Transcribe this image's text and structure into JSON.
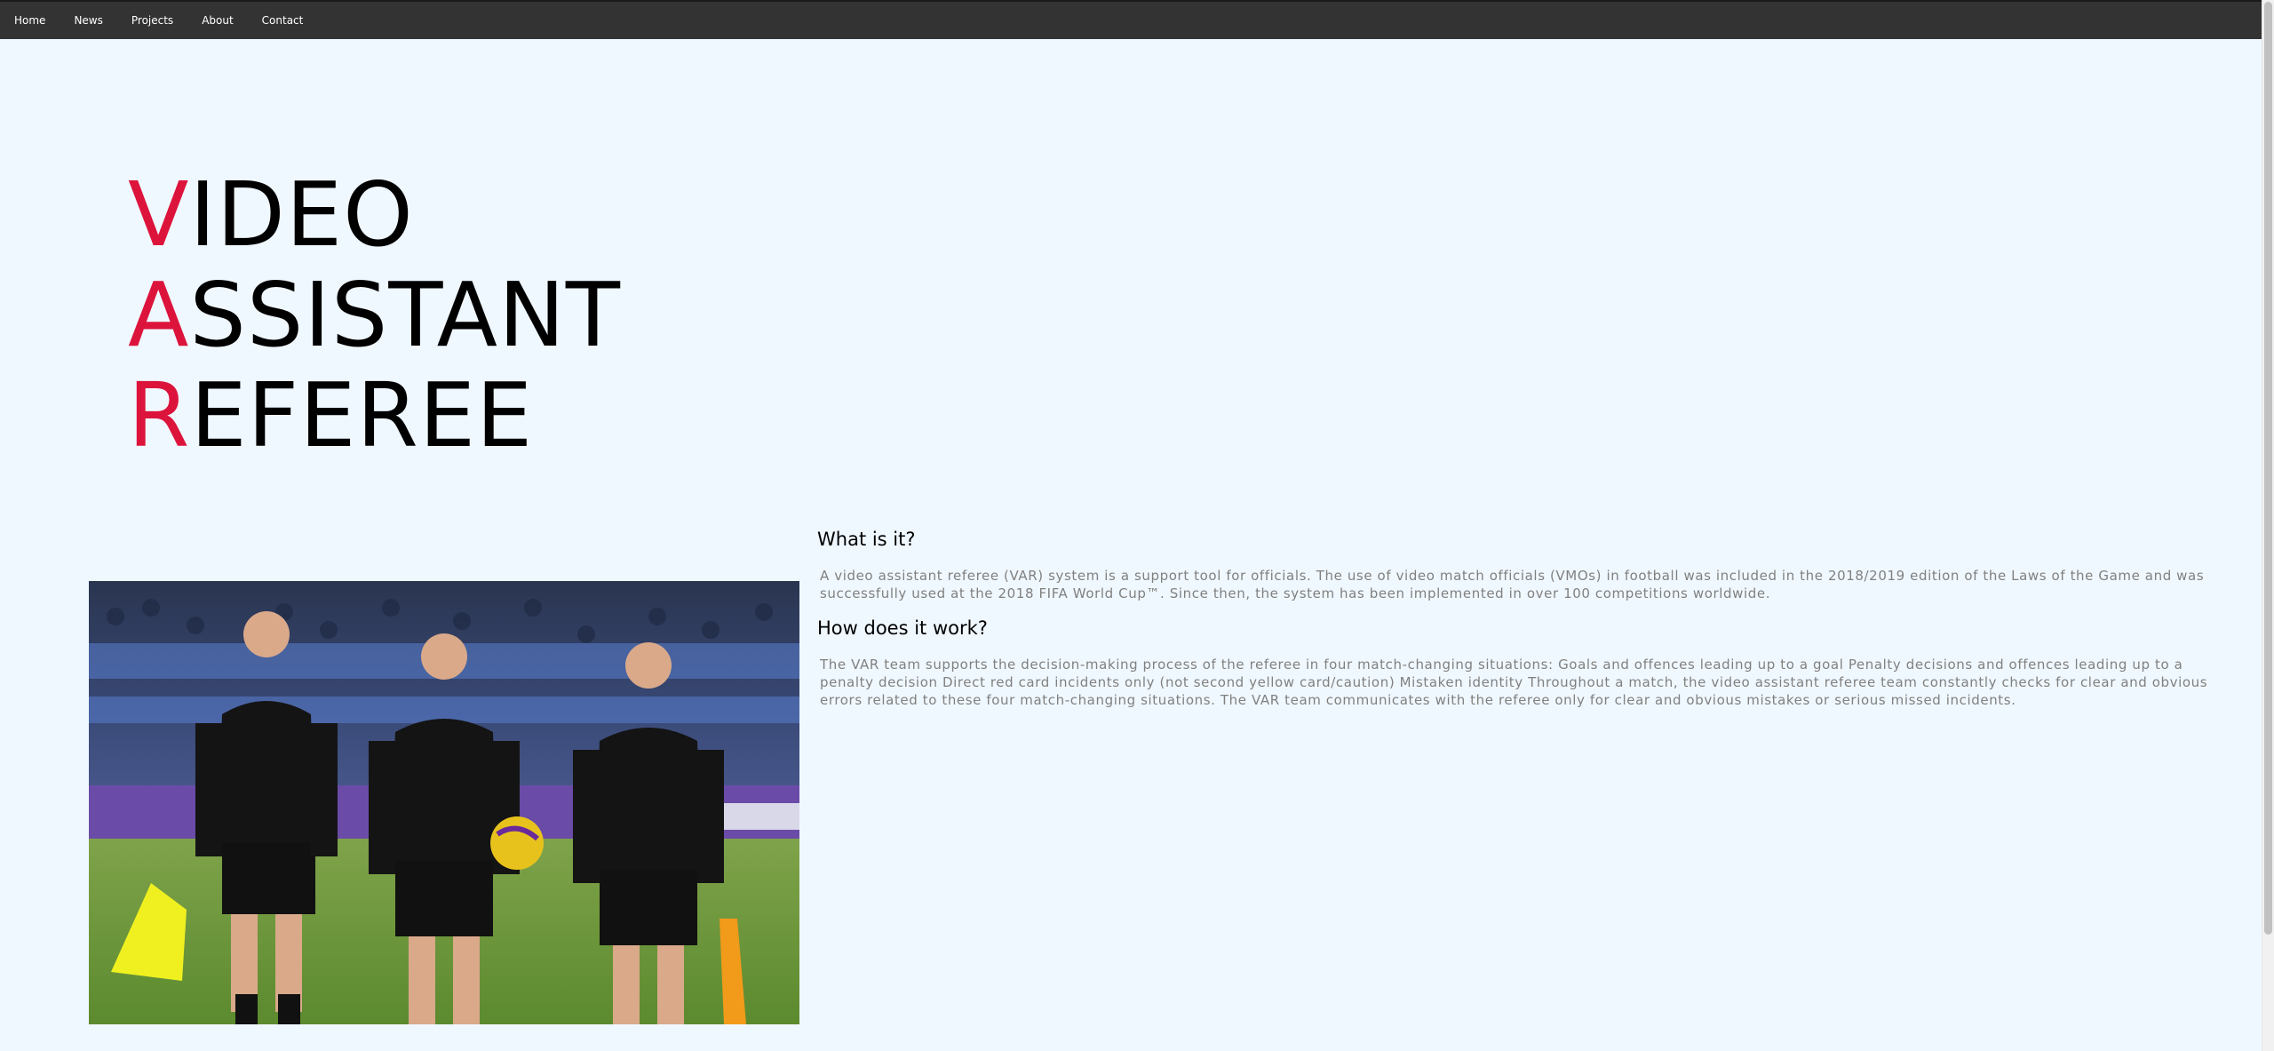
{
  "nav": {
    "items": [
      {
        "label": "Home"
      },
      {
        "label": "News"
      },
      {
        "label": "Projects"
      },
      {
        "label": "About"
      },
      {
        "label": "Contact"
      }
    ]
  },
  "hero": {
    "lines": [
      {
        "initial": "V",
        "rest": "IDEO"
      },
      {
        "initial": "A",
        "rest": "SSISTANT"
      },
      {
        "initial": "R",
        "rest": "EFEREE"
      }
    ]
  },
  "sections": [
    {
      "heading": "What is it?",
      "body": "A video assistant referee (VAR) system is a support tool for officials. The use of video match officials (VMOs) in football was included in the 2018/2019 edition of the Laws of the Game and was successfully used at the 2018 FIFA World Cup™. Since then, the system has been implemented in over 100 competitions worldwide."
    },
    {
      "heading": "How does it work?",
      "body": "The VAR team supports the decision-making process of the referee in four match-changing situations: Goals and offences leading up to a goal Penalty decisions and offences leading up to a penalty decision Direct red card incidents only (not second yellow card/caution) Mistaken identity Throughout a match, the video assistant referee team constantly checks for clear and obvious errors related to these four match-changing situations. The VAR team communicates with the referee only for clear and obvious mistakes or serious missed incidents."
    }
  ],
  "colors": {
    "accent": "#dc143c",
    "nav_bg": "#333333",
    "page_bg": "#f0f8ff",
    "body_text": "#808080"
  }
}
